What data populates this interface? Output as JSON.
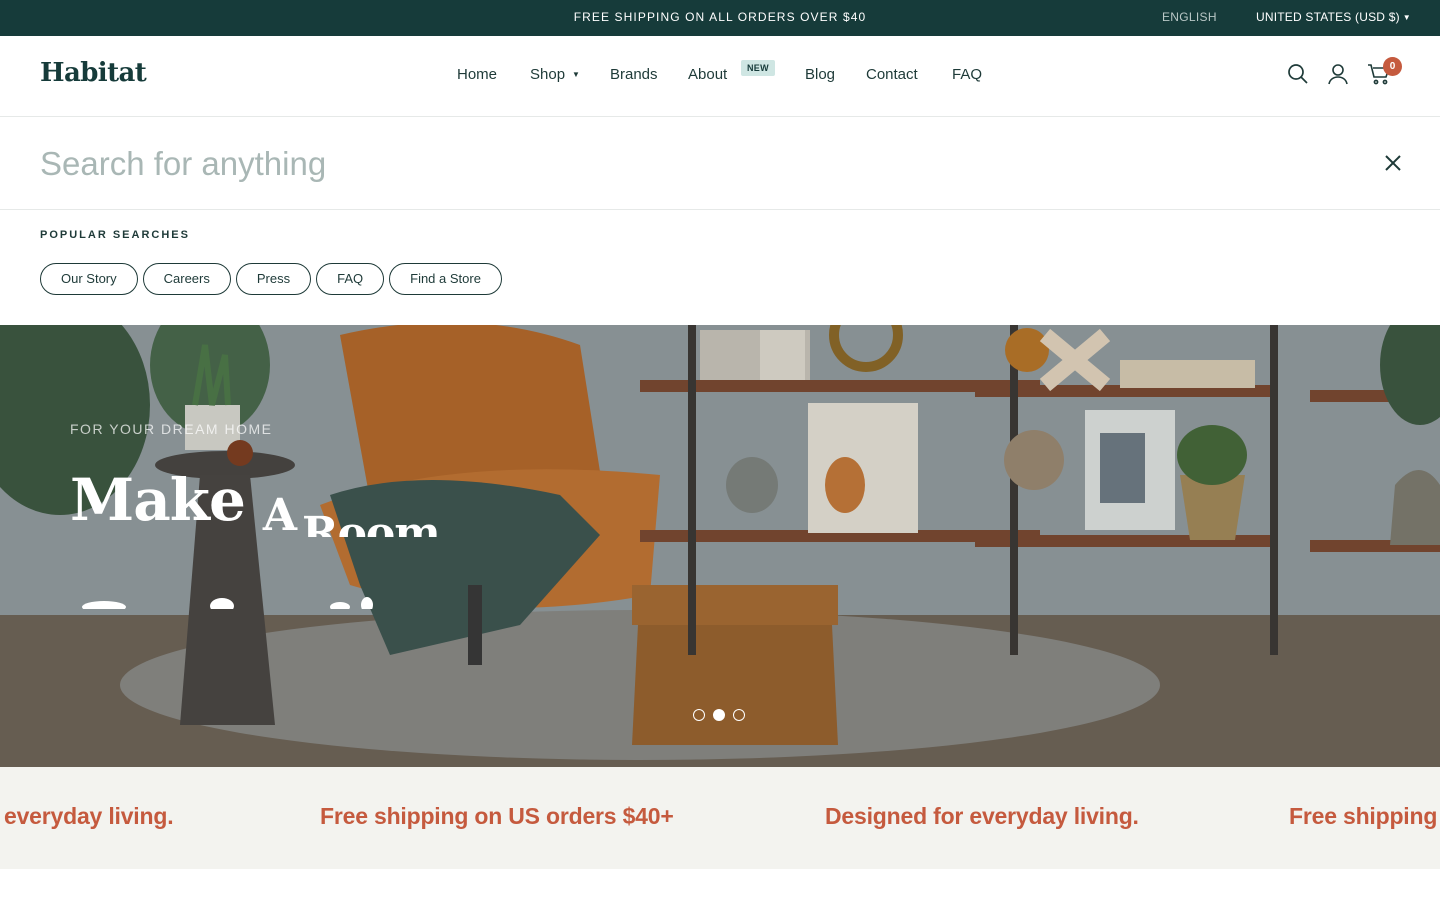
{
  "announcement": {
    "message": "FREE SHIPPING ON ALL ORDERS OVER $40",
    "language": "ENGLISH",
    "country": "UNITED STATES (USD $)"
  },
  "header": {
    "logo": "Habitat",
    "nav": [
      {
        "label": "Home"
      },
      {
        "label": "Shop",
        "has_dropdown": true
      },
      {
        "label": "Brands"
      },
      {
        "label": "About",
        "badge": "NEW"
      },
      {
        "label": "Blog"
      },
      {
        "label": "Contact"
      },
      {
        "label": "FAQ"
      }
    ],
    "icons": [
      "search-icon",
      "account-icon",
      "cart-icon"
    ],
    "cart_count": "0"
  },
  "search": {
    "placeholder": "Search for anything",
    "value": "",
    "popular_title": "POPULAR SEARCHES",
    "popular": [
      "Our Story",
      "Careers",
      "Press",
      "FAQ",
      "Find a Store"
    ]
  },
  "hero": {
    "eyebrow": "FOR YOUR DREAM HOME",
    "title_words": [
      "Make",
      "A",
      "Room"
    ],
    "slides": 3,
    "active_slide": 2
  },
  "marquee": {
    "items": [
      "everyday living.",
      "Free shipping on US orders $40+",
      "Designed for everyday living.",
      "Free shipping"
    ]
  },
  "colors": {
    "announcement_bg": "#163b3a",
    "brand_dark": "#163b3a",
    "accent": "#c55a3e",
    "marquee_bg": "#f3f3ef",
    "badge_bg": "#cfe6e3"
  }
}
